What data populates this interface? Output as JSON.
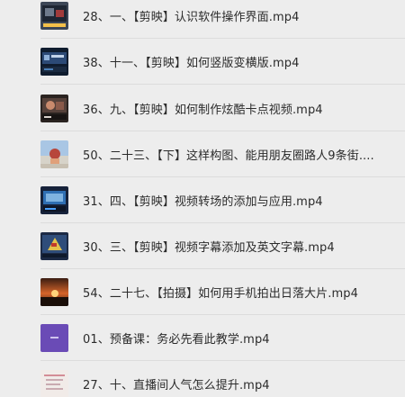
{
  "files": [
    {
      "title": "28、一、【剪映】认识软件操作界面.mp4",
      "thumb_icon": "video-thumbnail-icon"
    },
    {
      "title": "38、十一、【剪映】如何竖版变横版.mp4",
      "thumb_icon": "video-thumbnail-icon"
    },
    {
      "title": "36、九、【剪映】如何制作炫酷卡点视频.mp4",
      "thumb_icon": "video-thumbnail-icon"
    },
    {
      "title": "50、二十三、【下】这样构图、能用朋友圈路人9条街....",
      "thumb_icon": "video-thumbnail-icon"
    },
    {
      "title": "31、四、【剪映】视频转场的添加与应用.mp4",
      "thumb_icon": "video-thumbnail-icon"
    },
    {
      "title": "30、三、【剪映】视频字幕添加及英文字幕.mp4",
      "thumb_icon": "video-thumbnail-icon"
    },
    {
      "title": "54、二十七、【拍摄】如何用手机拍出日落大片.mp4",
      "thumb_icon": "video-thumbnail-icon"
    },
    {
      "title": "01、预备课：务必先看此教学.mp4",
      "thumb_icon": "video-thumbnail-icon"
    },
    {
      "title": "27、十、直播间人气怎么提升.mp4",
      "thumb_icon": "video-thumbnail-icon"
    }
  ]
}
